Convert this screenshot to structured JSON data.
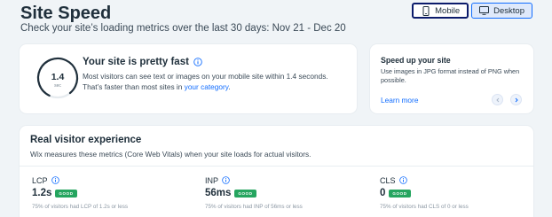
{
  "header": {
    "title": "Site Speed",
    "subtitle": "Check your site’s loading metrics over the last 30 days: Nov 21 - Dec 20",
    "toggle": {
      "mobile_label": "Mobile",
      "desktop_label": "Desktop",
      "selected": "Mobile",
      "mobile_icon": "mobile-phone-icon",
      "desktop_icon": "desktop-monitor-icon"
    }
  },
  "summary": {
    "gauge_value": "1.4",
    "gauge_unit": "sec",
    "gauge_fill_fraction": 0.82,
    "title": "Your site is pretty fast",
    "body_text": "Most visitors can see text or images on your mobile site within 1.4 seconds. That’s faster than most sites in ",
    "body_link": "your category",
    "body_end": "."
  },
  "tip": {
    "title": "Speed up your site",
    "body": "Use images in JPG format instead of PNG when possible.",
    "link": "Learn more",
    "prev_icon": "chevron-left-icon",
    "next_icon": "chevron-right-icon"
  },
  "visitor": {
    "title": "Real visitor experience",
    "subtitle": "Wix measures these metrics (Core Web Vitals) when your site loads for actual visitors.",
    "metrics": [
      {
        "label": "LCP",
        "value": "1.2s",
        "badge": "GOOD",
        "note": "75% of visitors had LCP of 1.2s or less"
      },
      {
        "label": "INP",
        "value": "56ms",
        "badge": "GOOD",
        "note": "75% of visitors had INP of 56ms or less"
      },
      {
        "label": "CLS",
        "value": "0",
        "badge": "GOOD",
        "note": "75% of visitors had CLS of 0 or less"
      }
    ]
  },
  "colors": {
    "accent": "#116dff",
    "good": "#25a55f",
    "background": "#f0f4f7",
    "text": "#20303c"
  }
}
